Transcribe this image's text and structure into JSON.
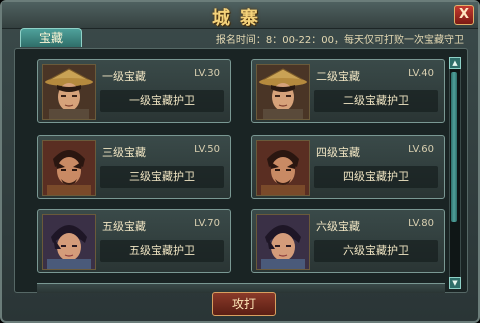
{
  "window": {
    "title": "城寨",
    "close_label": "X"
  },
  "tab": {
    "label": "宝藏"
  },
  "info": {
    "text": "报名时间：8：00-22：00，每天仅可打败一次宝藏守卫"
  },
  "cards": [
    {
      "treasure": "一级宝藏",
      "level": "LV.30",
      "guard": "一级宝藏护卫",
      "portrait": "straw-hat-warrior-icon"
    },
    {
      "treasure": "二级宝藏",
      "level": "LV.40",
      "guard": "二级宝藏护卫",
      "portrait": "straw-hat-warrior-icon"
    },
    {
      "treasure": "三级宝藏",
      "level": "LV.50",
      "guard": "三级宝藏护卫",
      "portrait": "bearded-warrior-icon"
    },
    {
      "treasure": "四级宝藏",
      "level": "LV.60",
      "guard": "四级宝藏护卫",
      "portrait": "bearded-warrior-icon"
    },
    {
      "treasure": "五级宝藏",
      "level": "LV.70",
      "guard": "五级宝藏护卫",
      "portrait": "young-warrior-icon"
    },
    {
      "treasure": "六级宝藏",
      "level": "LV.80",
      "guard": "六级宝藏护卫",
      "portrait": "young-warrior-icon"
    }
  ],
  "attack_button": {
    "label": "攻打"
  },
  "colors": {
    "accent": "#4fa19b",
    "title": "#f4d27a",
    "button": "#8a3a2a"
  }
}
